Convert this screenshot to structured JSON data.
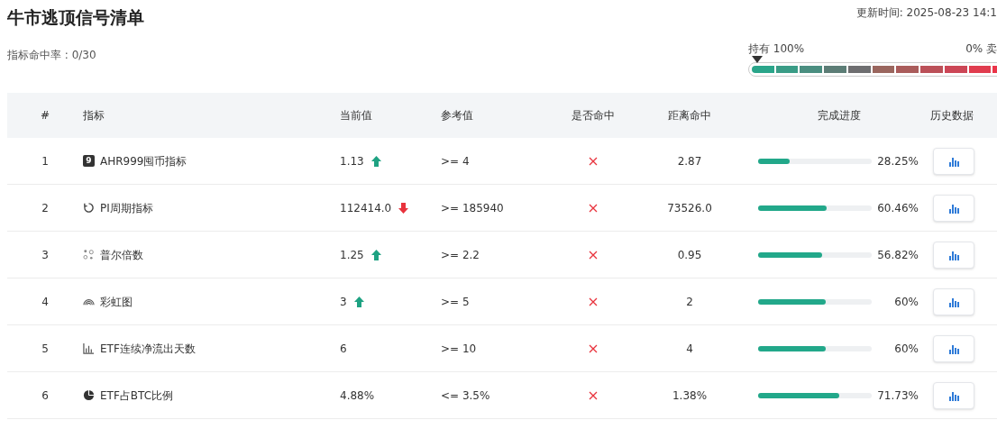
{
  "title": "牛市逃顶信号清单",
  "hit_rate": "指标命中率 : 0/30",
  "updated": "更新时间: 2025-08-23 14:1",
  "scale": {
    "left_label": "持有 100%",
    "right_label": "0% 卖",
    "level": 0,
    "segments": [
      {
        "color": "#2aa58a"
      },
      {
        "color": "#3a9c86"
      },
      {
        "color": "#4a8e80"
      },
      {
        "color": "#5c7d76"
      },
      {
        "color": "#6e6e70"
      },
      {
        "color": "#9a665e"
      },
      {
        "color": "#aa5c5b"
      },
      {
        "color": "#bb5058"
      },
      {
        "color": "#cc4656"
      },
      {
        "color": "#e03c4e"
      },
      {
        "color": "#ea3448"
      }
    ]
  },
  "table": {
    "columns": [
      "#",
      "指标",
      "当前值",
      "参考值",
      "是否命中",
      "距离命中",
      "完成进度",
      "历史数据"
    ],
    "rows": [
      {
        "index": "1",
        "badge": "9",
        "name": "AHR999囤币指标",
        "current": "1.13",
        "rising": true,
        "reference": ">= 4",
        "hit": false,
        "distance": "2.87",
        "level": 0.2825,
        "progress": "28.25%"
      },
      {
        "index": "2",
        "name": "PI周期指标",
        "current": "112414.0",
        "rising": false,
        "reference": ">= 185940",
        "hit": false,
        "distance": "73526.0",
        "level": 0.6046,
        "progress": "60.46%"
      },
      {
        "index": "3",
        "name": "普尔倍数",
        "current": "1.25",
        "rising": true,
        "reference": ">= 2.2",
        "hit": false,
        "distance": "0.95",
        "level": 0.5682,
        "progress": "56.82%"
      },
      {
        "index": "4",
        "name": "彩虹图",
        "current": "3",
        "rising": true,
        "reference": ">= 5",
        "hit": false,
        "distance": "2",
        "level": 0.6,
        "progress": "60%"
      },
      {
        "index": "5",
        "name": "ETF连续净流出天数",
        "current": "6",
        "reference": ">= 10",
        "hit": false,
        "distance": "4",
        "level": 0.6,
        "progress": "60%"
      },
      {
        "index": "6",
        "name": "ETF占BTC比例",
        "current": "4.88%",
        "reference": "<= 3.5%",
        "hit": false,
        "distance": "1.38%",
        "level": 0.7173,
        "progress": "71.73%"
      }
    ]
  }
}
